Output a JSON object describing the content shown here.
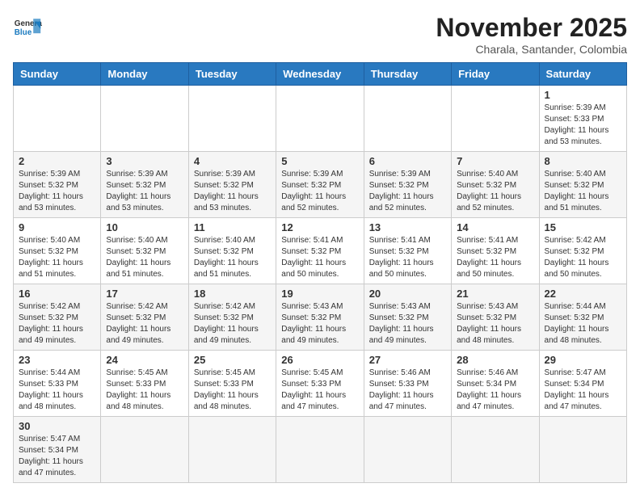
{
  "header": {
    "logo_general": "General",
    "logo_blue": "Blue",
    "month_year": "November 2025",
    "location": "Charala, Santander, Colombia"
  },
  "weekdays": [
    "Sunday",
    "Monday",
    "Tuesday",
    "Wednesday",
    "Thursday",
    "Friday",
    "Saturday"
  ],
  "weeks": [
    [
      {
        "day": "",
        "info": ""
      },
      {
        "day": "",
        "info": ""
      },
      {
        "day": "",
        "info": ""
      },
      {
        "day": "",
        "info": ""
      },
      {
        "day": "",
        "info": ""
      },
      {
        "day": "",
        "info": ""
      },
      {
        "day": "1",
        "info": "Sunrise: 5:39 AM\nSunset: 5:33 PM\nDaylight: 11 hours\nand 53 minutes."
      }
    ],
    [
      {
        "day": "2",
        "info": "Sunrise: 5:39 AM\nSunset: 5:32 PM\nDaylight: 11 hours\nand 53 minutes."
      },
      {
        "day": "3",
        "info": "Sunrise: 5:39 AM\nSunset: 5:32 PM\nDaylight: 11 hours\nand 53 minutes."
      },
      {
        "day": "4",
        "info": "Sunrise: 5:39 AM\nSunset: 5:32 PM\nDaylight: 11 hours\nand 53 minutes."
      },
      {
        "day": "5",
        "info": "Sunrise: 5:39 AM\nSunset: 5:32 PM\nDaylight: 11 hours\nand 52 minutes."
      },
      {
        "day": "6",
        "info": "Sunrise: 5:39 AM\nSunset: 5:32 PM\nDaylight: 11 hours\nand 52 minutes."
      },
      {
        "day": "7",
        "info": "Sunrise: 5:40 AM\nSunset: 5:32 PM\nDaylight: 11 hours\nand 52 minutes."
      },
      {
        "day": "8",
        "info": "Sunrise: 5:40 AM\nSunset: 5:32 PM\nDaylight: 11 hours\nand 51 minutes."
      }
    ],
    [
      {
        "day": "9",
        "info": "Sunrise: 5:40 AM\nSunset: 5:32 PM\nDaylight: 11 hours\nand 51 minutes."
      },
      {
        "day": "10",
        "info": "Sunrise: 5:40 AM\nSunset: 5:32 PM\nDaylight: 11 hours\nand 51 minutes."
      },
      {
        "day": "11",
        "info": "Sunrise: 5:40 AM\nSunset: 5:32 PM\nDaylight: 11 hours\nand 51 minutes."
      },
      {
        "day": "12",
        "info": "Sunrise: 5:41 AM\nSunset: 5:32 PM\nDaylight: 11 hours\nand 50 minutes."
      },
      {
        "day": "13",
        "info": "Sunrise: 5:41 AM\nSunset: 5:32 PM\nDaylight: 11 hours\nand 50 minutes."
      },
      {
        "day": "14",
        "info": "Sunrise: 5:41 AM\nSunset: 5:32 PM\nDaylight: 11 hours\nand 50 minutes."
      },
      {
        "day": "15",
        "info": "Sunrise: 5:42 AM\nSunset: 5:32 PM\nDaylight: 11 hours\nand 50 minutes."
      }
    ],
    [
      {
        "day": "16",
        "info": "Sunrise: 5:42 AM\nSunset: 5:32 PM\nDaylight: 11 hours\nand 49 minutes."
      },
      {
        "day": "17",
        "info": "Sunrise: 5:42 AM\nSunset: 5:32 PM\nDaylight: 11 hours\nand 49 minutes."
      },
      {
        "day": "18",
        "info": "Sunrise: 5:42 AM\nSunset: 5:32 PM\nDaylight: 11 hours\nand 49 minutes."
      },
      {
        "day": "19",
        "info": "Sunrise: 5:43 AM\nSunset: 5:32 PM\nDaylight: 11 hours\nand 49 minutes."
      },
      {
        "day": "20",
        "info": "Sunrise: 5:43 AM\nSunset: 5:32 PM\nDaylight: 11 hours\nand 49 minutes."
      },
      {
        "day": "21",
        "info": "Sunrise: 5:43 AM\nSunset: 5:32 PM\nDaylight: 11 hours\nand 48 minutes."
      },
      {
        "day": "22",
        "info": "Sunrise: 5:44 AM\nSunset: 5:32 PM\nDaylight: 11 hours\nand 48 minutes."
      }
    ],
    [
      {
        "day": "23",
        "info": "Sunrise: 5:44 AM\nSunset: 5:33 PM\nDaylight: 11 hours\nand 48 minutes."
      },
      {
        "day": "24",
        "info": "Sunrise: 5:45 AM\nSunset: 5:33 PM\nDaylight: 11 hours\nand 48 minutes."
      },
      {
        "day": "25",
        "info": "Sunrise: 5:45 AM\nSunset: 5:33 PM\nDaylight: 11 hours\nand 48 minutes."
      },
      {
        "day": "26",
        "info": "Sunrise: 5:45 AM\nSunset: 5:33 PM\nDaylight: 11 hours\nand 47 minutes."
      },
      {
        "day": "27",
        "info": "Sunrise: 5:46 AM\nSunset: 5:33 PM\nDaylight: 11 hours\nand 47 minutes."
      },
      {
        "day": "28",
        "info": "Sunrise: 5:46 AM\nSunset: 5:34 PM\nDaylight: 11 hours\nand 47 minutes."
      },
      {
        "day": "29",
        "info": "Sunrise: 5:47 AM\nSunset: 5:34 PM\nDaylight: 11 hours\nand 47 minutes."
      }
    ],
    [
      {
        "day": "30",
        "info": "Sunrise: 5:47 AM\nSunset: 5:34 PM\nDaylight: 11 hours\nand 47 minutes."
      },
      {
        "day": "",
        "info": ""
      },
      {
        "day": "",
        "info": ""
      },
      {
        "day": "",
        "info": ""
      },
      {
        "day": "",
        "info": ""
      },
      {
        "day": "",
        "info": ""
      },
      {
        "day": "",
        "info": ""
      }
    ]
  ]
}
